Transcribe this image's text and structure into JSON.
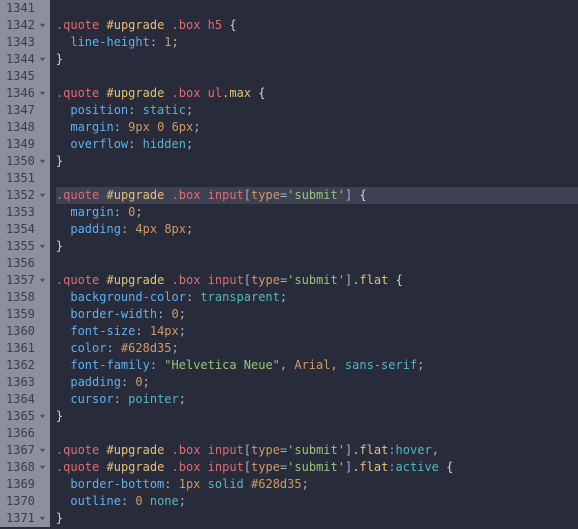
{
  "gutter": {
    "start": 1341,
    "end": 1371,
    "fold_lines": [
      1342,
      1344,
      1346,
      1350,
      1352,
      1355,
      1357,
      1365,
      1367,
      1368,
      1371
    ]
  },
  "active_line": 1352,
  "code": {
    "1341": [],
    "1342": [
      [
        "sel",
        ".quote"
      ],
      [
        "pun",
        " "
      ],
      [
        "id",
        "#upgrade"
      ],
      [
        "pun",
        " "
      ],
      [
        "sel",
        ".box"
      ],
      [
        "pun",
        " "
      ],
      [
        "tag",
        "h5"
      ],
      [
        "pun",
        " "
      ],
      [
        "brace",
        "{"
      ]
    ],
    "1343": [
      [
        "indent",
        "  "
      ],
      [
        "prop",
        "line-height"
      ],
      [
        "pun",
        ": "
      ],
      [
        "num",
        "1"
      ],
      [
        "pun",
        ";"
      ]
    ],
    "1344": [
      [
        "brace",
        "}"
      ]
    ],
    "1345": [],
    "1346": [
      [
        "sel",
        ".quote"
      ],
      [
        "pun",
        " "
      ],
      [
        "id",
        "#upgrade"
      ],
      [
        "pun",
        " "
      ],
      [
        "sel",
        ".box"
      ],
      [
        "pun",
        " "
      ],
      [
        "tag",
        "ul"
      ],
      [
        "class",
        ".max"
      ],
      [
        "pun",
        " "
      ],
      [
        "brace",
        "{"
      ]
    ],
    "1347": [
      [
        "indent",
        "  "
      ],
      [
        "prop",
        "position"
      ],
      [
        "pun",
        ": "
      ],
      [
        "kw",
        "static"
      ],
      [
        "pun",
        ";"
      ]
    ],
    "1348": [
      [
        "indent",
        "  "
      ],
      [
        "prop",
        "margin"
      ],
      [
        "pun",
        ": "
      ],
      [
        "num",
        "9px"
      ],
      [
        "pun",
        " "
      ],
      [
        "num",
        "0"
      ],
      [
        "pun",
        " "
      ],
      [
        "num",
        "6px"
      ],
      [
        "pun",
        ";"
      ]
    ],
    "1349": [
      [
        "indent",
        "  "
      ],
      [
        "prop",
        "overflow"
      ],
      [
        "pun",
        ": "
      ],
      [
        "kw",
        "hidden"
      ],
      [
        "pun",
        ";"
      ]
    ],
    "1350": [
      [
        "brace",
        "}"
      ]
    ],
    "1351": [],
    "1352": [
      [
        "sel",
        ".quote"
      ],
      [
        "pun",
        " "
      ],
      [
        "id",
        "#upgrade"
      ],
      [
        "pun",
        " "
      ],
      [
        "sel",
        ".box"
      ],
      [
        "pun",
        " "
      ],
      [
        "tag",
        "input"
      ],
      [
        "pun",
        "["
      ],
      [
        "attr",
        "type"
      ],
      [
        "pun",
        "="
      ],
      [
        "str",
        "'submit'"
      ],
      [
        "pun",
        "]"
      ],
      [
        "pun",
        " "
      ],
      [
        "brace",
        "{"
      ]
    ],
    "1353": [
      [
        "indent",
        "  "
      ],
      [
        "prop",
        "margin"
      ],
      [
        "pun",
        ": "
      ],
      [
        "num",
        "0"
      ],
      [
        "pun",
        ";"
      ]
    ],
    "1354": [
      [
        "indent",
        "  "
      ],
      [
        "prop",
        "padding"
      ],
      [
        "pun",
        ": "
      ],
      [
        "num",
        "4px"
      ],
      [
        "pun",
        " "
      ],
      [
        "num",
        "8px"
      ],
      [
        "pun",
        ";"
      ]
    ],
    "1355": [
      [
        "brace",
        "}"
      ]
    ],
    "1356": [],
    "1357": [
      [
        "sel",
        ".quote"
      ],
      [
        "pun",
        " "
      ],
      [
        "id",
        "#upgrade"
      ],
      [
        "pun",
        " "
      ],
      [
        "sel",
        ".box"
      ],
      [
        "pun",
        " "
      ],
      [
        "tag",
        "input"
      ],
      [
        "pun",
        "["
      ],
      [
        "attr",
        "type"
      ],
      [
        "pun",
        "="
      ],
      [
        "str",
        "'submit'"
      ],
      [
        "pun",
        "]"
      ],
      [
        "class",
        ".flat"
      ],
      [
        "pun",
        " "
      ],
      [
        "brace",
        "{"
      ]
    ],
    "1358": [
      [
        "indent",
        "  "
      ],
      [
        "prop",
        "background-color"
      ],
      [
        "pun",
        ": "
      ],
      [
        "kw",
        "transparent"
      ],
      [
        "pun",
        ";"
      ]
    ],
    "1359": [
      [
        "indent",
        "  "
      ],
      [
        "prop",
        "border-width"
      ],
      [
        "pun",
        ": "
      ],
      [
        "num",
        "0"
      ],
      [
        "pun",
        ";"
      ]
    ],
    "1360": [
      [
        "indent",
        "  "
      ],
      [
        "prop",
        "font-size"
      ],
      [
        "pun",
        ": "
      ],
      [
        "num",
        "14px"
      ],
      [
        "pun",
        ";"
      ]
    ],
    "1361": [
      [
        "indent",
        "  "
      ],
      [
        "prop",
        "color"
      ],
      [
        "pun",
        ": "
      ],
      [
        "num",
        "#628d35"
      ],
      [
        "pun",
        ";"
      ]
    ],
    "1362": [
      [
        "indent",
        "  "
      ],
      [
        "prop",
        "font-family"
      ],
      [
        "pun",
        ": "
      ],
      [
        "str",
        "\"Helvetica Neue\""
      ],
      [
        "pun",
        ", "
      ],
      [
        "font",
        "Arial"
      ],
      [
        "pun",
        ", "
      ],
      [
        "kw",
        "sans-serif"
      ],
      [
        "pun",
        ";"
      ]
    ],
    "1363": [
      [
        "indent",
        "  "
      ],
      [
        "prop",
        "padding"
      ],
      [
        "pun",
        ": "
      ],
      [
        "num",
        "0"
      ],
      [
        "pun",
        ";"
      ]
    ],
    "1364": [
      [
        "indent",
        "  "
      ],
      [
        "prop",
        "cursor"
      ],
      [
        "pun",
        ": "
      ],
      [
        "kw",
        "pointer"
      ],
      [
        "pun",
        ";"
      ]
    ],
    "1365": [
      [
        "brace",
        "}"
      ]
    ],
    "1366": [],
    "1367": [
      [
        "sel",
        ".quote"
      ],
      [
        "pun",
        " "
      ],
      [
        "id",
        "#upgrade"
      ],
      [
        "pun",
        " "
      ],
      [
        "sel",
        ".box"
      ],
      [
        "pun",
        " "
      ],
      [
        "tag",
        "input"
      ],
      [
        "pun",
        "["
      ],
      [
        "attr",
        "type"
      ],
      [
        "pun",
        "="
      ],
      [
        "str",
        "'submit'"
      ],
      [
        "pun",
        "]"
      ],
      [
        "class",
        ".flat"
      ],
      [
        "pseudo",
        ":hover"
      ],
      [
        "pun",
        ","
      ]
    ],
    "1368": [
      [
        "sel",
        ".quote"
      ],
      [
        "pun",
        " "
      ],
      [
        "id",
        "#upgrade"
      ],
      [
        "pun",
        " "
      ],
      [
        "sel",
        ".box"
      ],
      [
        "pun",
        " "
      ],
      [
        "tag",
        "input"
      ],
      [
        "pun",
        "["
      ],
      [
        "attr",
        "type"
      ],
      [
        "pun",
        "="
      ],
      [
        "str",
        "'submit'"
      ],
      [
        "pun",
        "]"
      ],
      [
        "class",
        ".flat"
      ],
      [
        "pseudo",
        ":active"
      ],
      [
        "pun",
        " "
      ],
      [
        "brace",
        "{"
      ]
    ],
    "1369": [
      [
        "indent",
        "  "
      ],
      [
        "prop",
        "border-bottom"
      ],
      [
        "pun",
        ": "
      ],
      [
        "num",
        "1px"
      ],
      [
        "pun",
        " "
      ],
      [
        "kw",
        "solid"
      ],
      [
        "pun",
        " "
      ],
      [
        "num",
        "#628d35"
      ],
      [
        "pun",
        ";"
      ]
    ],
    "1370": [
      [
        "indent",
        "  "
      ],
      [
        "prop",
        "outline"
      ],
      [
        "pun",
        ": "
      ],
      [
        "num",
        "0"
      ],
      [
        "pun",
        " "
      ],
      [
        "kw",
        "none"
      ],
      [
        "pun",
        ";"
      ]
    ],
    "1371": [
      [
        "brace",
        "}"
      ]
    ]
  }
}
